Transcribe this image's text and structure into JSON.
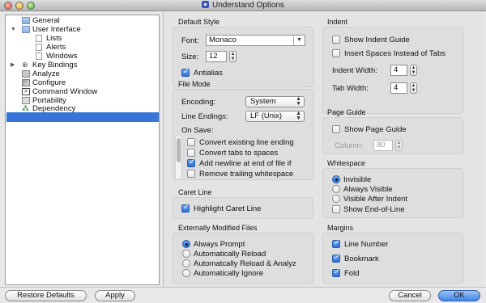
{
  "window": {
    "title": "Understand Options"
  },
  "sidebar": {
    "items": [
      {
        "label": "General"
      },
      {
        "label": "User Interface"
      },
      {
        "label": "Lists"
      },
      {
        "label": "Alerts"
      },
      {
        "label": "Windows"
      },
      {
        "label": "Key Bindings"
      },
      {
        "label": "Analyze"
      },
      {
        "label": "Configure"
      },
      {
        "label": "Command Window"
      },
      {
        "label": "Portability"
      },
      {
        "label": "Dependency"
      }
    ]
  },
  "default_style": {
    "title": "Default Style",
    "font_label": "Font:",
    "font_value": "Monaco",
    "size_label": "Size:",
    "size_value": "12",
    "antialias_label": "Antialias",
    "antialias_checked": true
  },
  "file_mode": {
    "title": "File Mode",
    "encoding_label": "Encoding:",
    "encoding_value": "System",
    "line_endings_label": "Line Endings:",
    "line_endings_value": "LF (Unix)",
    "on_save_label": "On Save:",
    "options": [
      {
        "label": "Convert existing line ending",
        "checked": false
      },
      {
        "label": "Convert tabs to spaces",
        "checked": false
      },
      {
        "label": "Add newline at end of file if",
        "checked": true
      },
      {
        "label": "Remove trailing whitespace",
        "checked": false
      }
    ]
  },
  "caret_line": {
    "title": "Caret Line",
    "highlight_label": "Highlight Caret Line",
    "highlight_checked": true
  },
  "externally_modified": {
    "title": "Externally Modified Files",
    "options": [
      {
        "label": "Always Prompt",
        "selected": true
      },
      {
        "label": "Automatically Reload",
        "selected": false
      },
      {
        "label": "Automatcally Reload & Analyz",
        "selected": false
      },
      {
        "label": "Automatically Ignore",
        "selected": false
      }
    ]
  },
  "indent": {
    "title": "Indent",
    "show_guide_label": "Show Indent Guide",
    "insert_spaces_label": "Insert Spaces Instead of Tabs",
    "indent_width_label": "Indent Width:",
    "indent_width_value": "4",
    "tab_width_label": "Tab Width:",
    "tab_width_value": "4"
  },
  "page_guide": {
    "title": "Page Guide",
    "show_label": "Show Page Guide",
    "column_label": "Column:",
    "column_value": "80"
  },
  "whitespace": {
    "title": "Whitespace",
    "options": [
      {
        "label": "Invisible",
        "selected": true
      },
      {
        "label": "Always Visible",
        "selected": false
      },
      {
        "label": "Visible After Indent",
        "selected": false
      }
    ],
    "show_eol_label": "Show End-of-Line"
  },
  "margins": {
    "title": "Margins",
    "options": [
      {
        "label": "Line Number",
        "checked": true
      },
      {
        "label": "Bookmark",
        "checked": true
      },
      {
        "label": "Fold",
        "checked": true
      }
    ]
  },
  "buttons": {
    "restore_defaults": "Restore Defaults",
    "apply": "Apply",
    "cancel": "Cancel",
    "ok": "OK"
  },
  "colors": {
    "selection": "#3875d7",
    "default_button": "#3e86e6"
  }
}
